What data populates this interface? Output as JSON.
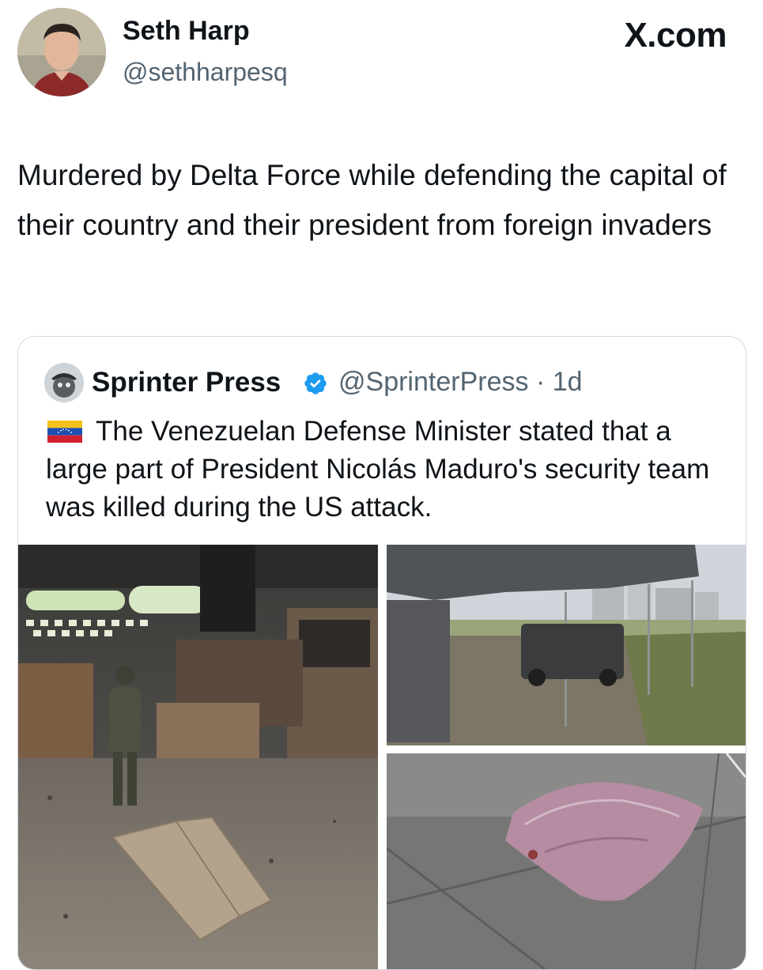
{
  "tweet": {
    "author_name": "Seth Harp",
    "author_handle": "@sethharpesq",
    "brand": "X.com",
    "text": "Murdered by Delta Force while defending the capital of their country and their president from foreign invaders"
  },
  "quoted_tweet": {
    "author_name": "Sprinter Press",
    "verified": true,
    "author_handle": "@SprinterPress",
    "time": "· 1d",
    "flag": "venezuela-flag",
    "text": "The Venezuelan Defense Minister stated that a large part of President Nicolás Maduro's security team was killed during the US attack.",
    "media": [
      {
        "name": "burned-vehicles-garage-photo"
      },
      {
        "name": "damaged-truck-under-tent-photo"
      },
      {
        "name": "covered-body-photo"
      }
    ]
  },
  "colors": {
    "text_primary": "#0f1419",
    "text_secondary": "#536471",
    "border": "#cfd9de",
    "verified_blue": "#1d9bf0"
  }
}
